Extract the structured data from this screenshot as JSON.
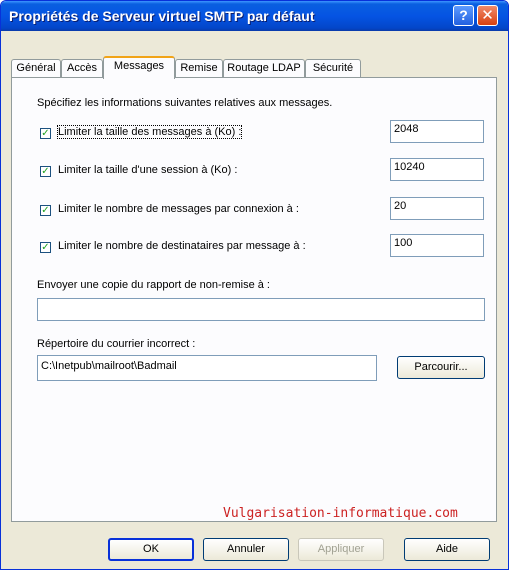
{
  "window": {
    "title": "Propriétés de Serveur virtuel SMTP par défaut",
    "help_symbol": "?",
    "close_symbol": "✕"
  },
  "tabs": [
    {
      "label": "Général",
      "active": false
    },
    {
      "label": "Accès",
      "active": false
    },
    {
      "label": "Messages",
      "active": true
    },
    {
      "label": "Remise",
      "active": false
    },
    {
      "label": "Routage LDAP",
      "active": false
    },
    {
      "label": "Sécurité",
      "active": false
    }
  ],
  "messages": {
    "intro": "Spécifiez les informations suivantes relatives aux messages.",
    "limits": [
      {
        "label": "Limiter la taille des messages à (Ko) :",
        "checked": true,
        "value": "2048"
      },
      {
        "label": "Limiter la taille d'une session à (Ko) :",
        "checked": true,
        "value": "10240"
      },
      {
        "label": "Limiter le nombre de messages par connexion à :",
        "checked": true,
        "value": "20"
      },
      {
        "label": "Limiter le nombre de destinataires par message à :",
        "checked": true,
        "value": "100"
      }
    ],
    "ndr_copy_label": "Envoyer une copie du rapport de non-remise à :",
    "ndr_copy_value": "",
    "badmail_label": "Répertoire du courrier incorrect :",
    "badmail_value": "C:\\Inetpub\\mailroot\\Badmail",
    "browse_label": "Parcourir..."
  },
  "watermark": "Vulgarisation-informatique.com",
  "buttons": {
    "ok": "OK",
    "cancel": "Annuler",
    "apply": "Appliquer",
    "help": "Aide"
  },
  "colors": {
    "titlebar": "#0554e3",
    "dialog_bg": "#ece9d8",
    "tab_highlight": "#f1a418",
    "watermark": "#cc2222"
  }
}
